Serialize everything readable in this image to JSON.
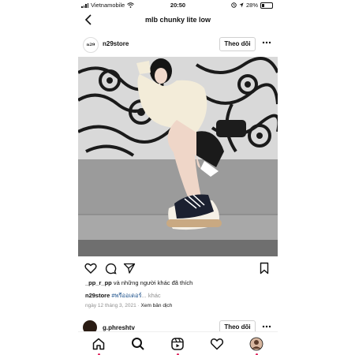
{
  "status_bar": {
    "carrier": "Vietnamobile",
    "time": "20:50",
    "battery": "28%"
  },
  "header": {
    "title": "mlb chunky lite low"
  },
  "post": {
    "avatar_text": "n29",
    "username": "n29store",
    "follow_label": "Theo dõi",
    "likes_user": "_pp_r_pp",
    "likes_rest": " và những người khác đã thích",
    "caption_user": "n29store",
    "caption_tag": "#พรีออเดอร์",
    "caption_more": "... khác",
    "date": "ngày 12 tháng 3, 2021",
    "translate": "Xem bản dịch"
  },
  "next_post": {
    "username": "g.phreshtv",
    "follow_label": "Theo dõi"
  },
  "icons": {
    "back": "chevron-left-icon",
    "more": "more-horizontal-icon",
    "like": "heart-icon",
    "comment": "comment-icon",
    "share": "send-icon",
    "save": "bookmark-icon",
    "home": "home-icon",
    "search": "search-icon",
    "reels": "reels-icon",
    "activity": "heart-icon",
    "profile": "profile-avatar"
  },
  "colors": {
    "link": "#1a4f8a",
    "notification_dot": "#e0245e"
  }
}
